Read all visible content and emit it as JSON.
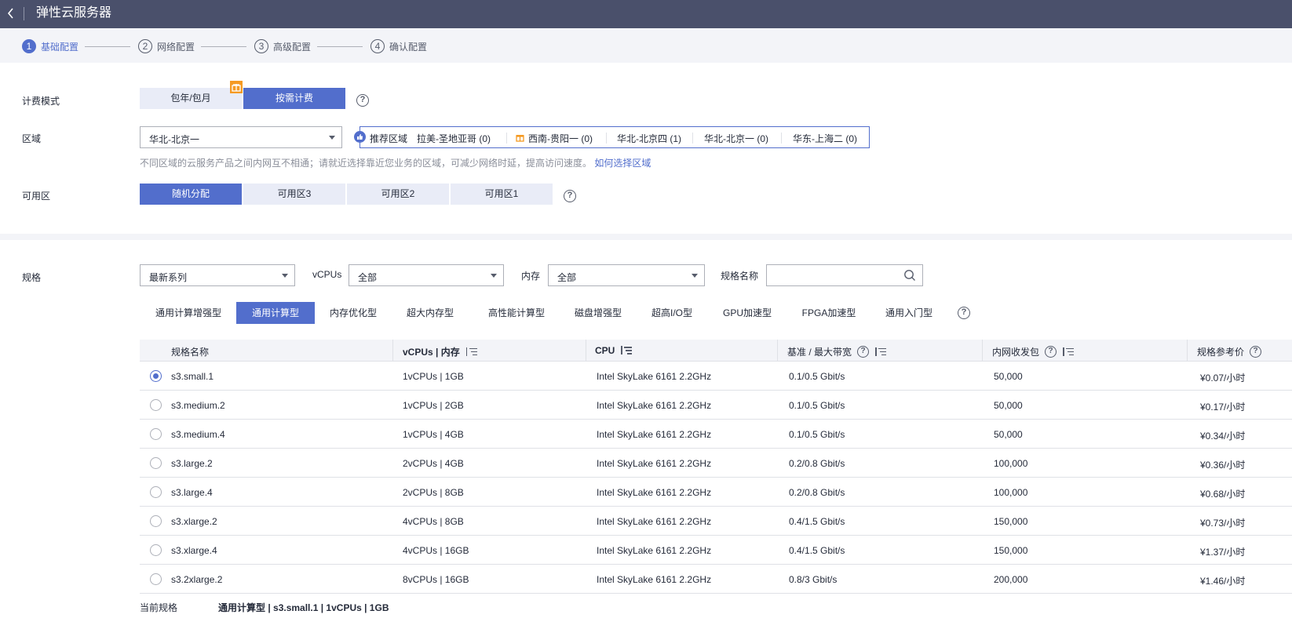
{
  "header": {
    "title": "弹性云服务器"
  },
  "steps": [
    {
      "num": "1",
      "label": "基础配置"
    },
    {
      "num": "2",
      "label": "网络配置"
    },
    {
      "num": "3",
      "label": "高级配置"
    },
    {
      "num": "4",
      "label": "确认配置"
    }
  ],
  "billing": {
    "label": "计费模式",
    "options": [
      "包年/包月",
      "按需计费"
    ],
    "selected": "按需计费"
  },
  "region": {
    "label": "区域",
    "value": "华北-北京一",
    "recommend_label": "推荐区域",
    "recommended": [
      "拉美-圣地亚哥 (0)",
      "西南-贵阳一 (0)",
      "华北-北京四 (1)",
      "华北-北京一 (0)",
      "华东-上海二 (0)"
    ],
    "hint": "不同区域的云服务产品之间内网互不相通；请就近选择靠近您业务的区域，可减少网络时延，提高访问速度。",
    "hint_link": "如何选择区域"
  },
  "az": {
    "label": "可用区",
    "options": [
      "随机分配",
      "可用区3",
      "可用区2",
      "可用区1"
    ],
    "selected": "随机分配"
  },
  "spec": {
    "label": "规格",
    "series": "最新系列",
    "vcpus_label": "vCPUs",
    "vcpus_value": "全部",
    "mem_label": "内存",
    "mem_value": "全部",
    "name_label": "规格名称",
    "name_placeholder": ""
  },
  "types": [
    "通用计算增强型",
    "通用计算型",
    "内存优化型",
    "超大内存型",
    "高性能计算型",
    "磁盘增强型",
    "超高I/O型",
    "GPU加速型",
    "FPGA加速型",
    "通用入门型"
  ],
  "selected_type": "通用计算型",
  "table": {
    "headers": [
      "规格名称",
      "vCPUs | 内存",
      "CPU",
      "基准 / 最大带宽",
      "内网收发包",
      "规格参考价"
    ],
    "rows": [
      {
        "name": "s3.small.1",
        "vm": "1vCPUs | 1GB",
        "cpu": "Intel SkyLake 6161 2.2GHz",
        "bw": "0.1/0.5 Gbit/s",
        "pps": "50,000",
        "price": "¥0.07/小时",
        "selected": true
      },
      {
        "name": "s3.medium.2",
        "vm": "1vCPUs | 2GB",
        "cpu": "Intel SkyLake 6161 2.2GHz",
        "bw": "0.1/0.5 Gbit/s",
        "pps": "50,000",
        "price": "¥0.17/小时",
        "selected": false
      },
      {
        "name": "s3.medium.4",
        "vm": "1vCPUs | 4GB",
        "cpu": "Intel SkyLake 6161 2.2GHz",
        "bw": "0.1/0.5 Gbit/s",
        "pps": "50,000",
        "price": "¥0.34/小时",
        "selected": false
      },
      {
        "name": "s3.large.2",
        "vm": "2vCPUs | 4GB",
        "cpu": "Intel SkyLake 6161 2.2GHz",
        "bw": "0.2/0.8 Gbit/s",
        "pps": "100,000",
        "price": "¥0.36/小时",
        "selected": false
      },
      {
        "name": "s3.large.4",
        "vm": "2vCPUs | 8GB",
        "cpu": "Intel SkyLake 6161 2.2GHz",
        "bw": "0.2/0.8 Gbit/s",
        "pps": "100,000",
        "price": "¥0.68/小时",
        "selected": false
      },
      {
        "name": "s3.xlarge.2",
        "vm": "4vCPUs | 8GB",
        "cpu": "Intel SkyLake 6161 2.2GHz",
        "bw": "0.4/1.5 Gbit/s",
        "pps": "150,000",
        "price": "¥0.73/小时",
        "selected": false
      },
      {
        "name": "s3.xlarge.4",
        "vm": "4vCPUs | 16GB",
        "cpu": "Intel SkyLake 6161 2.2GHz",
        "bw": "0.4/1.5 Gbit/s",
        "pps": "150,000",
        "price": "¥1.37/小时",
        "selected": false
      },
      {
        "name": "s3.2xlarge.2",
        "vm": "8vCPUs | 16GB",
        "cpu": "Intel SkyLake 6161 2.2GHz",
        "bw": "0.8/3 Gbit/s",
        "pps": "200,000",
        "price": "¥1.46/小时",
        "selected": false
      }
    ]
  },
  "current": {
    "label": "当前规格",
    "value": "通用计算型 | s3.small.1 | 1vCPUs | 1GB"
  },
  "icons": {
    "help": "?",
    "back": "back-icon",
    "gift": "gift-icon",
    "thumb": "thumbs-up-icon"
  },
  "colors": {
    "accent": "#526ecc",
    "header": "#4a506b",
    "gift": "#f59a23"
  }
}
